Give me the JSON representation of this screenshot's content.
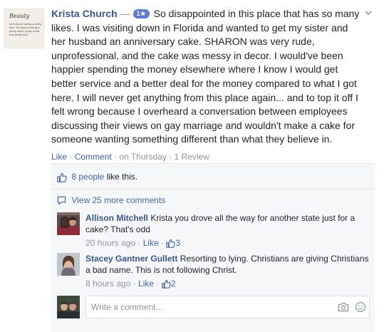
{
  "post": {
    "avatar_title": "Beauty",
    "avatar_text": "isn't about having a pretty face. It's about having a pretty mind, pretty heart and pretty soul.",
    "author": "Krista Church",
    "dash": "—",
    "rating_badge": "1★",
    "text": "So disappointed in this place that has so many likes. I was visiting down in Florida and wanted to get my sister and her husband an anniversary cake. SHARON was very rude, unprofessional, and the cake was messy in decor. I would've been happier spending the money elsewhere where I know I would get better service and a better deal for the money compared to what I got here. I will never get anything from this place again... and to top it off I felt wrong because I overheard a conversation between employees discussing their views on gay marriage and wouldn't make a cake for someone wanting something different than what they believe in.",
    "actions": {
      "like": "Like",
      "sep1": " · ",
      "comment": "Comment",
      "sep2": " · ",
      "time": "on Thursday",
      "sep3": " · ",
      "reviews": "1 Review"
    }
  },
  "feedback": {
    "likes_link": "8 people",
    "likes_suffix": " like this.",
    "view_more": "View 25 more comments",
    "comments": [
      {
        "author": "Allison Mitchell",
        "text": "Krista you drove all the way for another state just for a cake? That's odd",
        "time": "20 hours ago",
        "sep": " · ",
        "like": "Like",
        "sep2": " · ",
        "like_count": "3"
      },
      {
        "author": "Stacey Gantner Gullett",
        "text": "Resorting to lying. Christians are giving Christians a bad name. This is not following Christ.",
        "time": "8 hours ago",
        "sep": " · ",
        "like": "Like",
        "sep2": " · ",
        "like_count": "2"
      }
    ],
    "comment_placeholder": "Write a comment..."
  },
  "colors": {
    "link": "#4267b2",
    "author": "#365899",
    "meta": "#90949c",
    "feedback_bg": "#f6f7f9",
    "badge": "#5b7bd5"
  },
  "icons": [
    "chevron-down-icon",
    "thumbs-up-icon",
    "comment-bubble-icon",
    "camera-icon",
    "emoji-icon"
  ]
}
